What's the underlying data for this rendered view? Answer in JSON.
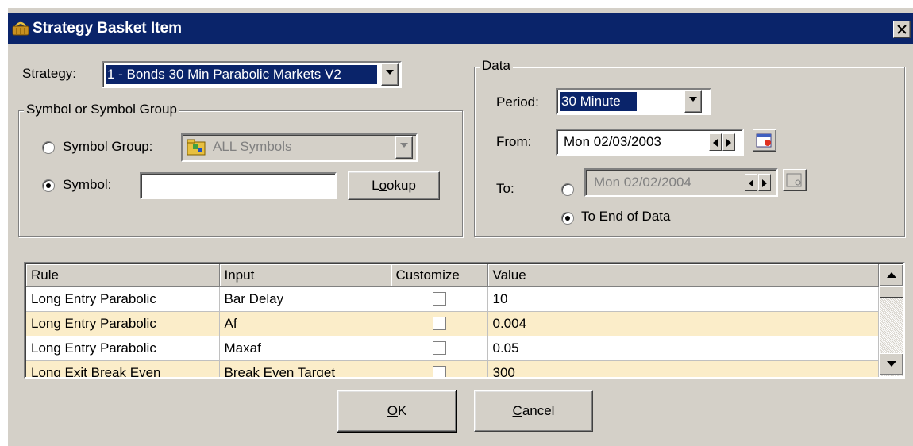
{
  "window": {
    "title": "Strategy Basket Item"
  },
  "strategy": {
    "label": "Strategy:",
    "value": "1 - Bonds 30 Min Parabolic Markets V2"
  },
  "symbol_group_box": {
    "legend": "Symbol or Symbol Group",
    "group_label": "Symbol Group:",
    "group_value": "ALL Symbols",
    "symbol_label": "Symbol:",
    "symbol_value": "",
    "lookup_label": "Lookup",
    "lookup_accel": "o",
    "lookup_pre": "L",
    "lookup_post": "okup"
  },
  "data_box": {
    "legend": "Data",
    "period_label": "Period:",
    "period_value": "30 Minute",
    "from_label": "From:",
    "from_value": "Mon 02/03/2003",
    "to_label": "To:",
    "to_value": "Mon 02/02/2004",
    "to_end_label": "To End of Data"
  },
  "grid": {
    "columns": [
      "Rule",
      "Input",
      "Customize",
      "Value"
    ],
    "rows": [
      {
        "rule": "Long Entry Parabolic",
        "input": "Bar Delay",
        "value": "10"
      },
      {
        "rule": "Long Entry Parabolic",
        "input": "Af",
        "value": "0.004"
      },
      {
        "rule": "Long Entry Parabolic",
        "input": "Maxaf",
        "value": "0.05"
      },
      {
        "rule": "Long Exit Break Even",
        "input": "Break Even Target",
        "value": "300"
      }
    ]
  },
  "buttons": {
    "ok_accel": "O",
    "ok_rest": "K",
    "cancel_accel": "C",
    "cancel_rest": "ancel"
  },
  "colors": {
    "title_bar": "#0a246a",
    "dialog_bg": "#d4d0c8",
    "alt_row": "#fbedc9"
  }
}
